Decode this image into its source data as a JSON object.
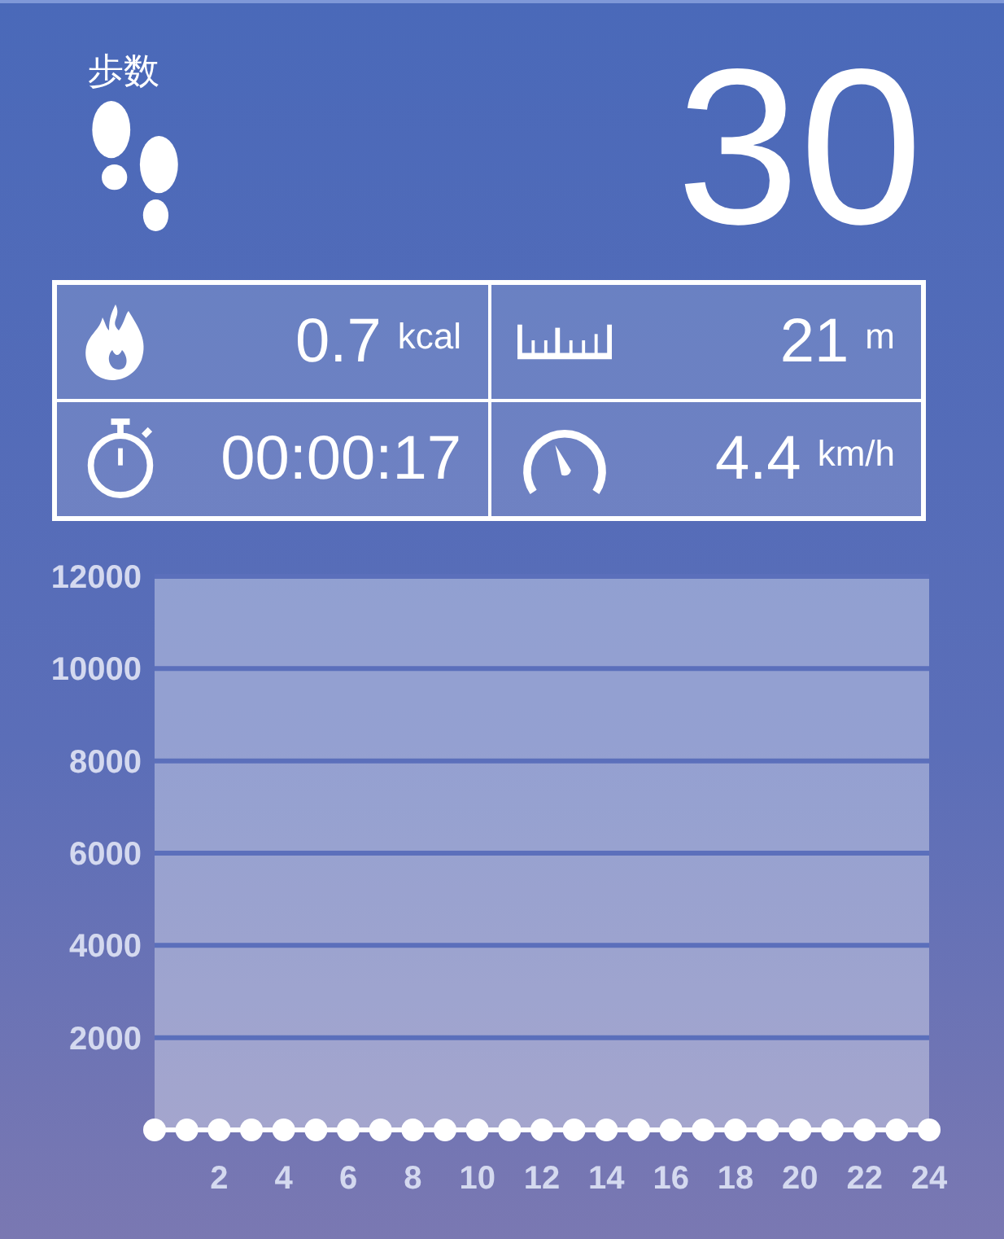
{
  "header": {
    "label": "歩数",
    "steps": "30"
  },
  "stats": [
    {
      "kind": "calories",
      "value": "0.7",
      "unit": "kcal"
    },
    {
      "kind": "distance",
      "value": "21",
      "unit": "m"
    },
    {
      "kind": "duration",
      "value": "00:00:17"
    },
    {
      "kind": "speed",
      "value": "4.4",
      "unit": "km/h"
    }
  ],
  "chart": {
    "chart_data": {
      "type": "line",
      "x": [
        0,
        1,
        2,
        3,
        4,
        5,
        6,
        7,
        8,
        9,
        10,
        11,
        12,
        13,
        14,
        15,
        16,
        17,
        18,
        19,
        20,
        21,
        22,
        23,
        24
      ],
      "grid": true,
      "series": [
        {
          "color": "#ffffff",
          "marker": "circle",
          "values": [
            0,
            0,
            0,
            0,
            0,
            0,
            0,
            0,
            0,
            0,
            0,
            0,
            0,
            0,
            0,
            0,
            0,
            0,
            0,
            0,
            0,
            0,
            0,
            0,
            0
          ]
        }
      ],
      "xlim": [
        0,
        24
      ],
      "ylim": [
        0,
        12000
      ],
      "xticks": [
        2,
        4,
        6,
        8,
        10,
        12,
        14,
        16,
        18,
        20,
        22,
        24
      ],
      "yticks": [
        2000,
        4000,
        6000,
        8000,
        10000,
        12000
      ]
    }
  }
}
